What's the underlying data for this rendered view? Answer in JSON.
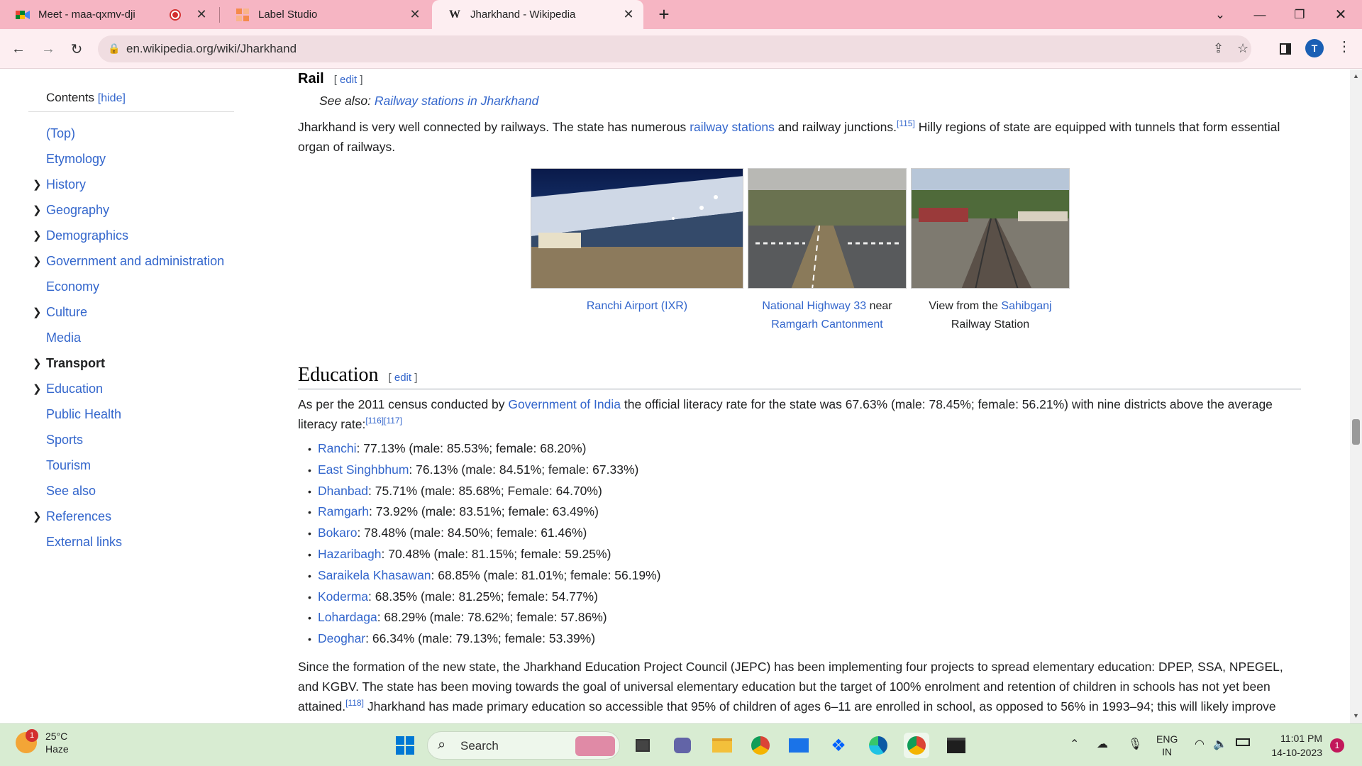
{
  "browser": {
    "tabs": [
      {
        "title": "Meet - maa-qxmv-dji",
        "recording": true
      },
      {
        "title": "Label Studio"
      },
      {
        "title": "Jharkhand - Wikipedia",
        "favicon": "W",
        "active": true
      }
    ],
    "url": "en.wikipedia.org/wiki/Jharkhand",
    "profile_initial": "T"
  },
  "toc": {
    "title": "Contents",
    "hide_label": "[hide]",
    "items": [
      {
        "label": "(Top)",
        "expandable": false
      },
      {
        "label": "Etymology",
        "expandable": false
      },
      {
        "label": "History",
        "expandable": true
      },
      {
        "label": "Geography",
        "expandable": true
      },
      {
        "label": "Demographics",
        "expandable": true
      },
      {
        "label": "Government and administration",
        "expandable": true
      },
      {
        "label": "Economy",
        "expandable": false
      },
      {
        "label": "Culture",
        "expandable": true
      },
      {
        "label": "Media",
        "expandable": false
      },
      {
        "label": "Transport",
        "expandable": true,
        "current": true
      },
      {
        "label": "Education",
        "expandable": true
      },
      {
        "label": "Public Health",
        "expandable": false
      },
      {
        "label": "Sports",
        "expandable": false
      },
      {
        "label": "Tourism",
        "expandable": false
      },
      {
        "label": "See also",
        "expandable": false
      },
      {
        "label": "References",
        "expandable": true
      },
      {
        "label": "External links",
        "expandable": false
      }
    ]
  },
  "article": {
    "rail_heading": "Rail",
    "edit_label": "edit",
    "see_also_prefix": "See also:",
    "see_also_link": "Railway stations in Jharkhand",
    "rail_p1": "Jharkhand is very well connected by railways. The state has numerous",
    "rail_link": "railway stations",
    "rail_p2": "and railway junctions.",
    "rail_ref": "[115]",
    "rail_p3": "Hilly regions of state are equipped with tunnels that form essential",
    "rail_p4": "organ of railways.",
    "captions": {
      "c1": "Ranchi Airport (IXR)",
      "c2_link": "National Highway 33",
      "c2_mid": "near",
      "c2_link2": "Ramgarh Cantonment",
      "c3_pre": "View from the",
      "c3_link": "Sahibganj",
      "c3_post": "Railway Station"
    },
    "edu_heading": "Education",
    "edu_p1_pre": "As per the 2011 census conducted by",
    "edu_p1_link": "Government of India",
    "edu_p1_post": "the official literacy rate for the state was 67.63% (male: 78.45%; female: 56.21%) with nine districts above the average",
    "edu_p1_line2": "literacy rate:",
    "edu_p1_ref": "[116][117]",
    "districts": [
      {
        "name": "Ranchi",
        "text": ": 77.13% (male: 85.53%; female: 68.20%)"
      },
      {
        "name": "East Singhbhum",
        "text": ": 76.13% (male: 84.51%; female: 67.33%)"
      },
      {
        "name": "Dhanbad",
        "text": ": 75.71% (male: 85.68%; Female: 64.70%)"
      },
      {
        "name": "Ramgarh",
        "text": ": 73.92% (male: 83.51%; female: 63.49%)"
      },
      {
        "name": "Bokaro",
        "text": ": 78.48% (male: 84.50%; female: 61.46%)"
      },
      {
        "name": "Hazaribagh",
        "text": ": 70.48% (male: 81.15%; female: 59.25%)"
      },
      {
        "name": "Saraikela Khasawan",
        "text": ": 68.85% (male: 81.01%; female: 56.19%)"
      },
      {
        "name": "Koderma",
        "text": ": 68.35% (male: 81.25%; female: 54.77%)"
      },
      {
        "name": "Lohardaga",
        "text": ": 68.29% (male: 78.62%; female: 57.86%)"
      },
      {
        "name": "Deoghar",
        "text": ": 66.34% (male: 79.13%; female: 53.39%)"
      }
    ],
    "edu_p2_l1": "Since the formation of the new state, the Jharkhand Education Project Council (JEPC) has been implementing four projects to spread elementary education: DPEP, SSA, NPEGEL,",
    "edu_p2_l2": "and KGBV. The state has been moving towards the goal of universal elementary education but the target of 100% enrolment and retention of children in schools has not yet been",
    "edu_p2_l3a": "attained.",
    "edu_p2_ref": "[118]",
    "edu_p2_l3b": "Jharkhand has made primary education so accessible that 95% of children of ages 6–11 are enrolled in school, as opposed to 56% in 1993–94; this will likely improve"
  },
  "taskbar": {
    "weather_temp": "25°C",
    "weather_desc": "Haze",
    "weather_badge": "1",
    "search_placeholder": "Search",
    "lang_top": "ENG",
    "lang_bottom": "IN",
    "time": "11:01 PM",
    "date": "14-10-2023",
    "notifications": "1"
  },
  "colors": {
    "link": "#3366cc",
    "tabbar": "#f6b5c3",
    "taskbar": "#d8ecd2"
  }
}
